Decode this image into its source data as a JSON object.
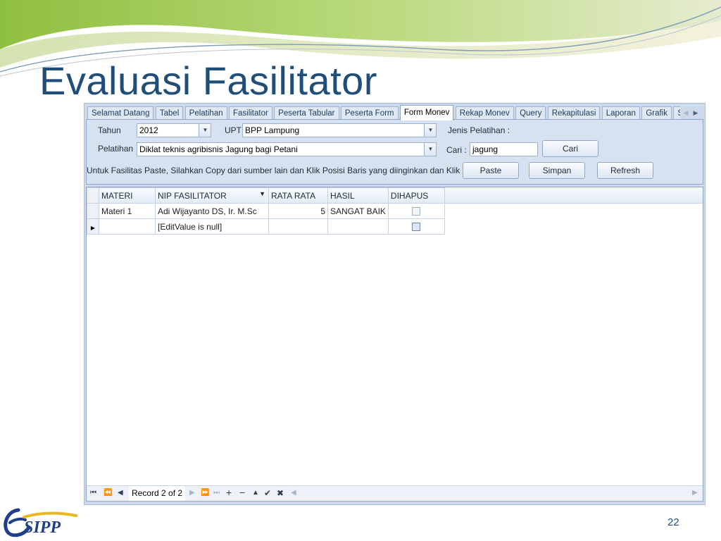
{
  "slide": {
    "title": "Evaluasi Fasilitator",
    "page_number": "22",
    "logo_text": "SIPP"
  },
  "tabs": [
    {
      "label": "Selamat Datang",
      "active": false
    },
    {
      "label": "Tabel",
      "active": false
    },
    {
      "label": "Pelatihan",
      "active": false
    },
    {
      "label": "Fasilitator",
      "active": false
    },
    {
      "label": "Peserta Tabular",
      "active": false
    },
    {
      "label": "Peserta Form",
      "active": false
    },
    {
      "label": "Form Monev",
      "active": true
    },
    {
      "label": "Rekap Monev",
      "active": false
    },
    {
      "label": "Query",
      "active": false
    },
    {
      "label": "Rekapitulasi",
      "active": false
    },
    {
      "label": "Laporan",
      "active": false
    },
    {
      "label": "Grafik",
      "active": false
    },
    {
      "label": "Sinkro",
      "active": false
    }
  ],
  "form": {
    "tahun_label": "Tahun",
    "tahun_value": "2012",
    "upt_label": "UPT",
    "upt_value": "BPP Lampung",
    "jenis_label": "Jenis Pelatihan :",
    "pelatihan_label": "Pelatihan",
    "pelatihan_value": "Diklat teknis agribisnis Jagung bagi Petani",
    "cari_label": "Cari :",
    "cari_value": "jagung",
    "cari_button": "Cari",
    "instruction": "Untuk Fasilitas Paste, Silahkan Copy dari sumber lain dan Klik Posisi Baris yang diinginkan dan Klik Paste",
    "paste_button": "Paste",
    "simpan_button": "Simpan",
    "refresh_button": "Refresh"
  },
  "grid": {
    "columns": [
      "MATERI",
      "NIP FASILITATOR",
      "RATA RATA",
      "HASIL",
      "DIHAPUS"
    ],
    "rows": [
      {
        "materi": "Materi 1",
        "fasilitator": "Adi Wijayanto DS, Ir. M.Sc",
        "rata_rata": "5",
        "hasil": "SANGAT BAIK",
        "dihapus": false
      },
      {
        "materi": "",
        "fasilitator": "[EditValue is null]",
        "rata_rata": "",
        "hasil": "",
        "dihapus": false
      }
    ],
    "navigator_record": "Record 2 of 2"
  },
  "colors": {
    "title": "#1f4e79",
    "panel": "#d6e2f1",
    "frame": "#ccdaeb"
  },
  "icons": {
    "tab_prev": "chevron-left-icon",
    "tab_next": "chevron-right-icon",
    "filter": "filter-icon",
    "row_pointer": "row-pointer-icon",
    "dropdown": "chevron-down-icon"
  }
}
